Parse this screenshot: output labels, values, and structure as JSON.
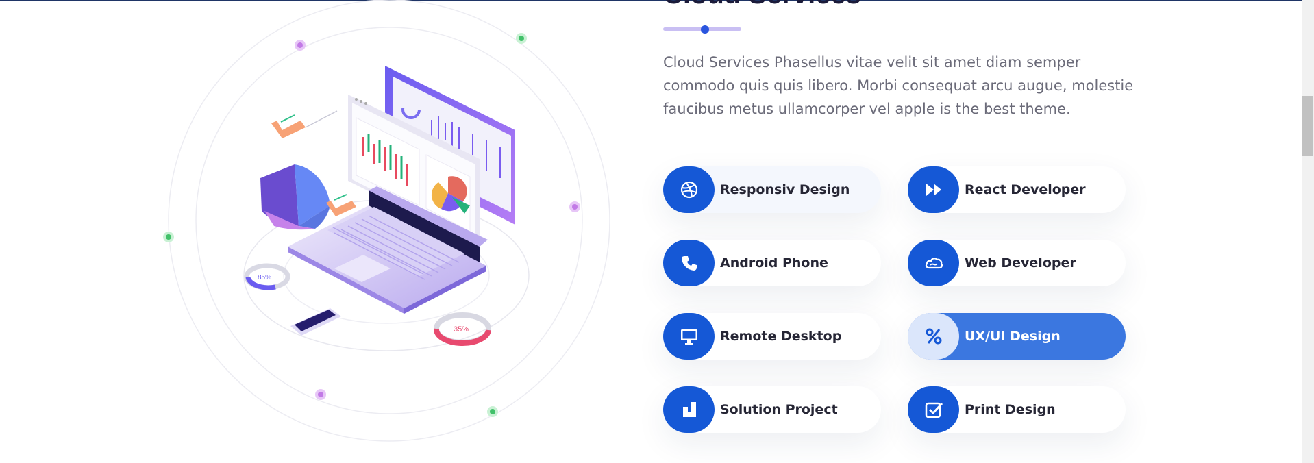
{
  "section": {
    "title": "Cloud Services",
    "description": "Cloud Services Phasellus vitae velit sit amet diam semper commodo quis quis libero. Morbi consequat arcu augue, molestie faucibus metus ullamcorper vel apple is the best theme."
  },
  "illustration": {
    "badge_small": "85%",
    "badge_gauge": "35%"
  },
  "services": [
    {
      "label": "Responsiv Design",
      "icon": "dribbble-icon"
    },
    {
      "label": "React Developer",
      "icon": "fast-forward-icon"
    },
    {
      "label": "Android Phone",
      "icon": "phone-icon"
    },
    {
      "label": "Web Developer",
      "icon": "cloud-icon"
    },
    {
      "label": "Remote Desktop",
      "icon": "desktop-icon"
    },
    {
      "label": "UX/UI Design",
      "icon": "percent-icon"
    },
    {
      "label": "Solution Project",
      "icon": "deviantart-icon"
    },
    {
      "label": "Print Design",
      "icon": "check-square-icon"
    }
  ],
  "colors": {
    "accent": "#1558d6",
    "active_card": "#3b77e0",
    "heading": "#1b1b3a",
    "text": "#6b6b79"
  }
}
